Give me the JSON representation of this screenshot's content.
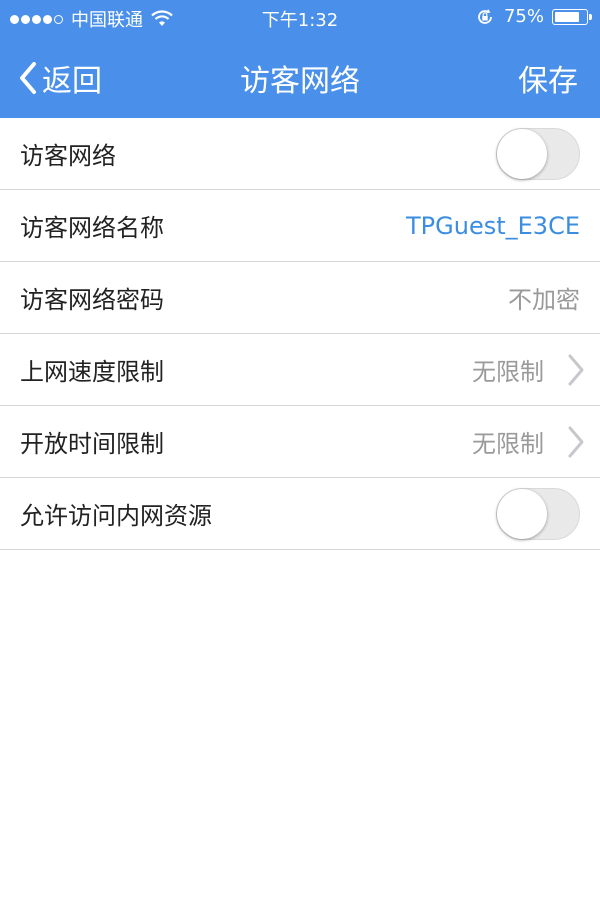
{
  "status_bar": {
    "carrier": "中国联通",
    "time": "下午1:32",
    "battery": "75%"
  },
  "nav": {
    "back_label": "返回",
    "title": "访客网络",
    "save_label": "保存"
  },
  "settings": [
    {
      "label": "访客网络",
      "type": "toggle",
      "on": false
    },
    {
      "label": "访客网络名称",
      "value": "TPGuest_E3CE"
    },
    {
      "label": "访客网络密码",
      "value": "不加密"
    },
    {
      "label": "上网速度限制",
      "value": "无限制"
    },
    {
      "label": "开放时间限制",
      "value": "无限制"
    },
    {
      "label": "允许访问内网资源",
      "type": "toggle",
      "on": false
    }
  ],
  "colors": {
    "accent": "#4a90ea",
    "link": "#3a8de0",
    "value_gray": "#9a9a9a"
  },
  "icons": [
    "signal-dots-icon",
    "wifi-icon",
    "rotation-lock-icon",
    "battery-icon",
    "chevron-left-icon",
    "chevron-right-icon"
  ]
}
